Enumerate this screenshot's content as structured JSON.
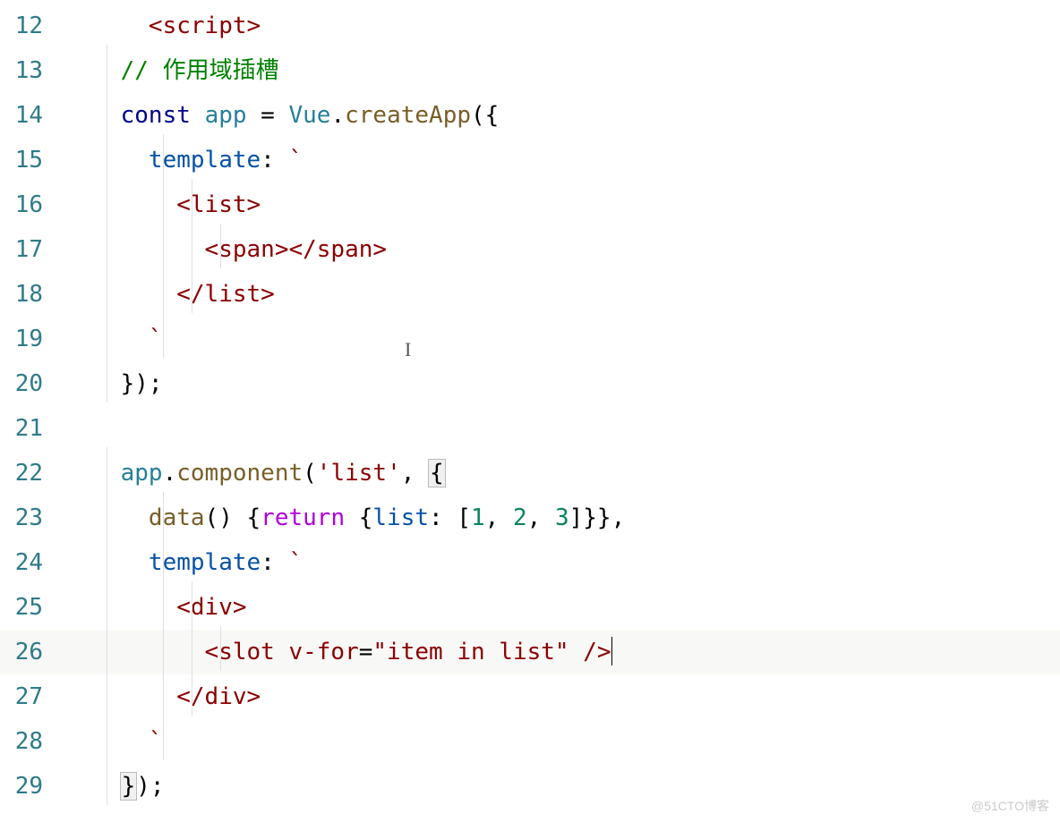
{
  "watermark": "@51CTO博客",
  "lines": [
    {
      "num": "12"
    },
    {
      "num": "13",
      "comment": "// 作用域插槽"
    },
    {
      "num": "14"
    },
    {
      "num": "15"
    },
    {
      "num": "16"
    },
    {
      "num": "17"
    },
    {
      "num": "18"
    },
    {
      "num": "19"
    },
    {
      "num": "20"
    },
    {
      "num": "21"
    },
    {
      "num": "22"
    },
    {
      "num": "23"
    },
    {
      "num": "24"
    },
    {
      "num": "25"
    },
    {
      "num": "26"
    },
    {
      "num": "27"
    },
    {
      "num": "28"
    },
    {
      "num": "29"
    }
  ],
  "tokens": {
    "script_open": "<script>",
    "const": "const",
    "app": "app",
    "eq": " = ",
    "Vue": "Vue",
    "dot": ".",
    "createApp": "createApp",
    "lparen_brace": "({",
    "template": "template",
    "colon": ":",
    "backtick": "`",
    "list_open": "<list>",
    "span": "<span></span>",
    "list_close": "</list>",
    "rbrace_paren_semi": "});",
    "component": "component",
    "lparen": "(",
    "list_str": "'list'",
    "comma_sp": ", ",
    "lbrace": "{",
    "data": "data",
    "parens": "()",
    "sp_lbrace": " {",
    "return": "return",
    "list_key": "list",
    "arr_open": "[",
    "n1": "1",
    "n2": "2",
    "n3": "3",
    "arr_close": "]",
    "rbrace": "}",
    "comma": ",",
    "div_open": "<div>",
    "slot_open": "<slot ",
    "vfor": "v-for",
    "eq2": "=",
    "vfor_val": "\"item in list\"",
    "slot_close": " />",
    "div_close": "</div>"
  }
}
